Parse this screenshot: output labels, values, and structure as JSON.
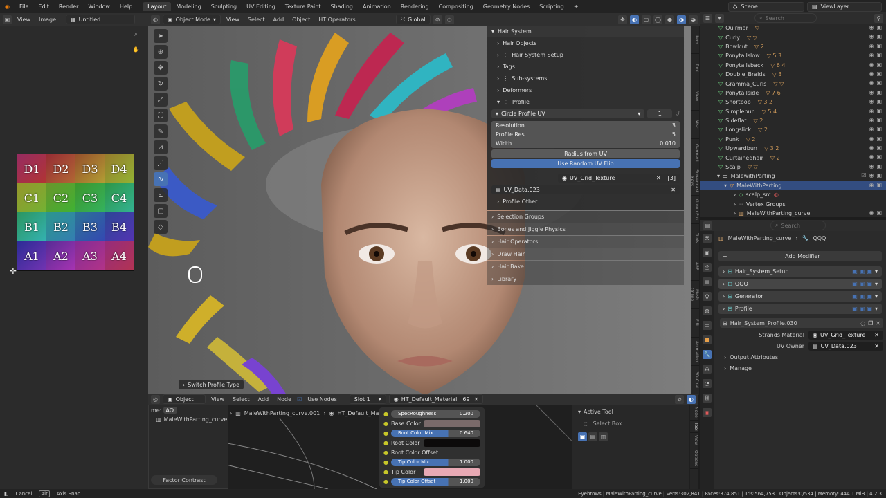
{
  "menubar": {
    "items": [
      "File",
      "Edit",
      "Render",
      "Window",
      "Help"
    ]
  },
  "workspaces": [
    "Layout",
    "Modeling",
    "Sculpting",
    "UV Editing",
    "Texture Paint",
    "Shading",
    "Animation",
    "Rendering",
    "Compositing",
    "Geometry Nodes",
    "Scripting"
  ],
  "active_workspace": "Layout",
  "add_workspace": "+",
  "scene": "Scene",
  "viewlayer": "ViewLayer",
  "image_editor": {
    "menu": [
      "View",
      "Image"
    ],
    "image_name": "Untitled",
    "grid_labels": [
      [
        "D1",
        "D2",
        "D3",
        "D4"
      ],
      [
        "C1",
        "C2",
        "C3",
        "C4"
      ],
      [
        "B1",
        "B2",
        "B3",
        "B4"
      ],
      [
        "A1",
        "A2",
        "A3",
        "A4"
      ]
    ]
  },
  "viewport_header": {
    "mode": "Object Mode",
    "menu": [
      "View",
      "Select",
      "Add",
      "Object",
      "HT Operators"
    ],
    "transform": "Global"
  },
  "viewport": {
    "operator_panel": "Switch Profile Type"
  },
  "npanel": {
    "title": "Hair System",
    "hair_objects": "Hair Objects",
    "system_setup": "Hair System Setup",
    "tags": "Tags",
    "subsystems": "Sub-systems",
    "deformers": "Deformers",
    "profile": "Profile",
    "profile_type": "Circle Profile UV",
    "profile_count": "1",
    "resolution_label": "Resolution",
    "resolution_value": "3",
    "profile_res_label": "Profile Res",
    "profile_res_value": "5",
    "width_label": "Width",
    "width_value": "0.010",
    "radius_btn": "Radius from UV",
    "random_flip_btn": "Use Random UV Flip",
    "texture": "UV_Grid_Texture",
    "texture_count": "[3]",
    "uv_data": "UV_Data.023",
    "profile_other": "Profile Other",
    "sections": [
      "Selection Groups",
      "Bones and Jiggle Physics",
      "Hair Operators",
      "Draw Hair",
      "Hair Bake",
      "Library"
    ],
    "sidetabs": [
      "Item",
      "Tool",
      "View",
      "Misc",
      "Garment",
      "Screencast Keys",
      "Group Pro",
      "Tools",
      "ARP",
      "Mesh Online",
      "Edit",
      "Animation",
      "3D-Coat"
    ]
  },
  "outliner": {
    "search_placeholder": "Search",
    "items": [
      {
        "name": "Quirmar",
        "extra": "▽"
      },
      {
        "name": "Curly",
        "extra": "▽ ▽"
      },
      {
        "name": "Bowlcut",
        "extra": "▽ 2"
      },
      {
        "name": "Ponytailslow",
        "extra": "▽ 5 3"
      },
      {
        "name": "Ponytailsback",
        "extra": "▽ 6 4"
      },
      {
        "name": "Double_Braids",
        "extra": "▽ 3"
      },
      {
        "name": "Gramma_Curls",
        "extra": "▽ ▽"
      },
      {
        "name": "Ponytailside",
        "extra": "▽ 7 6"
      },
      {
        "name": "Shortbob",
        "extra": "▽ 3 2"
      },
      {
        "name": "Simplebun",
        "extra": "▽ 5 4"
      },
      {
        "name": "Sideflat",
        "extra": "▽ 2"
      },
      {
        "name": "Longslick",
        "extra": "▽ 2"
      },
      {
        "name": "Punk",
        "extra": "▽ 2"
      },
      {
        "name": "Upwardbun",
        "extra": "▽ 3 2"
      },
      {
        "name": "Curtainedhair",
        "extra": "▽ 2"
      },
      {
        "name": "Scalp",
        "extra": "▽ ▽"
      }
    ],
    "collection": "MalewithParting",
    "object": "MaleWithParting",
    "children": [
      "scalp_src",
      "Vertex Groups",
      "MaleWithParting_curve"
    ]
  },
  "properties": {
    "search_placeholder": "Search",
    "breadcrumb_object": "MaleWithParting_curve",
    "breadcrumb_mod": "QQQ",
    "add_modifier": "Add Modifier",
    "modifiers": [
      "Hair_System_Setup",
      "QQQ",
      "Generator",
      "Profile"
    ],
    "nodegroup": "Hair_System_Profile.030",
    "strands_material_label": "Strands Material",
    "strands_material": "UV_Grid_Texture",
    "uv_owner_label": "UV Owner",
    "uv_owner": "UV_Data.023",
    "output_attributes": "Output Attributes",
    "manage": "Manage"
  },
  "node_editor": {
    "object": "Object",
    "menu": [
      "View",
      "Select",
      "Add",
      "Node"
    ],
    "use_nodes": "Use Nodes",
    "slot": "Slot 1",
    "material": "HT_Default_Material",
    "users": "69",
    "name_label": "me:",
    "name_value": "AO",
    "breadcrumb": [
      "MaleWithParting_curve",
      "MaleWithParting_curve.001",
      "HT_Default_Mat"
    ],
    "factor_node": "Factor Contrast",
    "sockets": [
      {
        "label": "SpecRoughness",
        "value": "0.200",
        "type": "bar"
      },
      {
        "label": "Base Color",
        "value": "",
        "type": "color",
        "color": "#7a6a6a"
      },
      {
        "label": "Root Color Mix",
        "value": "0.640",
        "type": "bar-blue"
      },
      {
        "label": "Root Color",
        "value": "",
        "type": "color",
        "color": "#0c0a0a"
      },
      {
        "label": "Root Color Offset",
        "value": "",
        "type": "plain"
      },
      {
        "label": "Tip Color Mix",
        "value": "1.000",
        "type": "bar-blue"
      },
      {
        "label": "Tip Color",
        "value": "",
        "type": "color",
        "color": "#e8a9b4"
      },
      {
        "label": "Tip Color Offset",
        "value": "1.000",
        "type": "bar-blue"
      }
    ],
    "active_tool_title": "Active Tool",
    "active_tool": "Select Box",
    "sidetabs": [
      "Node",
      "Tool",
      "View",
      "Options"
    ]
  },
  "statusbar": {
    "left": [
      "Cancel",
      "Axis Snap"
    ],
    "right": "Eyebrows | MaleWithParting_curve | Verts:302,841 | Faces:374,851 | Tris:564,753 | Objects:0/534 | Memory: 444.1 MiB | 4.2.3"
  },
  "colors": {
    "accent": "#4772b3",
    "header": "#303030",
    "panel": "#2b2b2b"
  }
}
